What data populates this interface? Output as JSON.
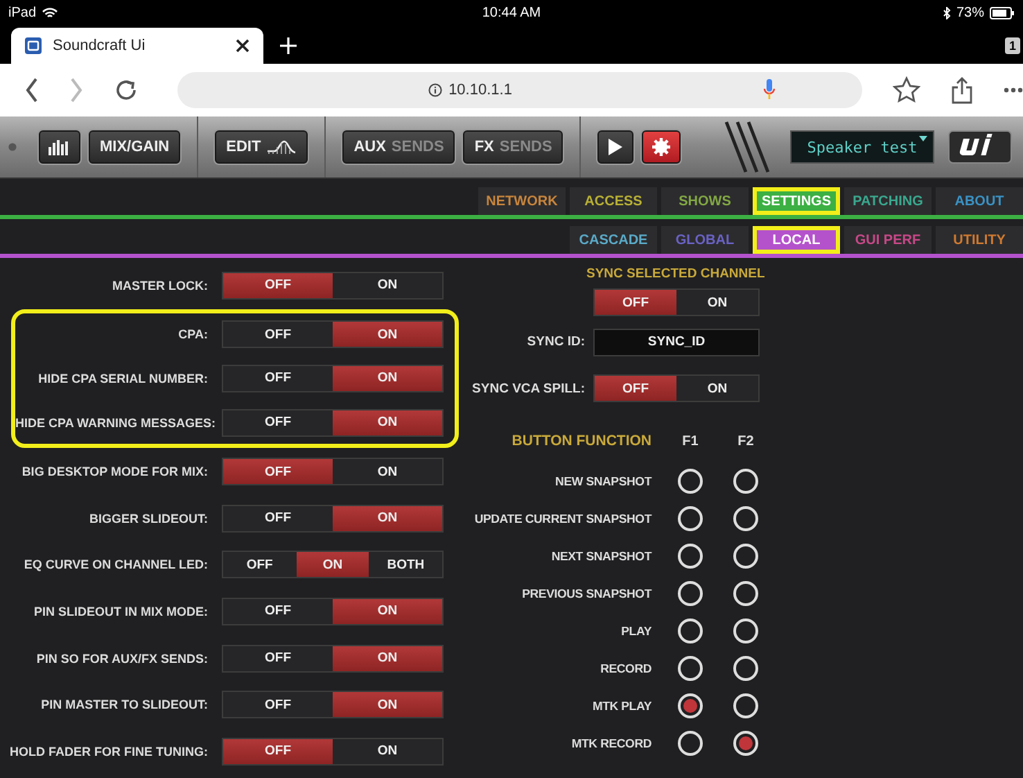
{
  "status_bar": {
    "device": "iPad",
    "time": "10:44 AM",
    "battery": "73%"
  },
  "browser": {
    "tab_title": "Soundcraft Ui",
    "tab_count": "1",
    "url": "10.10.1.1"
  },
  "toolbar": {
    "buttons": [
      {
        "kind": "meter"
      },
      {
        "kind": "text",
        "main": "MIX/GAIN"
      },
      {
        "kind": "edit",
        "main": "EDIT"
      },
      {
        "kind": "split",
        "main": "AUX",
        "sub": "SENDS"
      },
      {
        "kind": "split",
        "main": "FX",
        "sub": "SENDS"
      },
      {
        "kind": "play"
      },
      {
        "kind": "gear"
      }
    ],
    "display": "Speaker test"
  },
  "tabs": [
    {
      "label": "NETWORK",
      "color": "#c8853c",
      "selected": false,
      "highlighted": false
    },
    {
      "label": "ACCESS",
      "color": "#b8b035",
      "selected": false,
      "highlighted": false
    },
    {
      "label": "SHOWS",
      "color": "#82a844",
      "selected": false,
      "highlighted": false
    },
    {
      "label": "SETTINGS",
      "color": "#3cb043",
      "selected": true,
      "highlighted": true
    },
    {
      "label": "PATCHING",
      "color": "#3aa88e",
      "selected": false,
      "highlighted": false
    },
    {
      "label": "ABOUT",
      "color": "#3a92c4",
      "selected": false,
      "highlighted": false
    }
  ],
  "subtabs": [
    {
      "label": "CASCADE",
      "color": "#5aaac8",
      "selected": false,
      "highlighted": false
    },
    {
      "label": "GLOBAL",
      "color": "#6a62c4",
      "selected": false,
      "highlighted": false
    },
    {
      "label": "LOCAL",
      "color": "#b452cc",
      "selected": true,
      "highlighted": true
    },
    {
      "label": "GUI PERF",
      "color": "#c84888",
      "selected": false,
      "highlighted": false
    },
    {
      "label": "UTILITY",
      "color": "#d07a30",
      "selected": false,
      "highlighted": false
    }
  ],
  "settings": [
    {
      "kind": "toggle",
      "label": "MASTER LOCK:",
      "options": [
        {
          "label": "OFF",
          "selected": true
        },
        {
          "label": "ON",
          "selected": false
        }
      ]
    },
    {
      "kind": "group",
      "highlighted": true,
      "items": [
        {
          "kind": "toggle",
          "label": "CPA:",
          "options": [
            {
              "label": "OFF",
              "selected": false
            },
            {
              "label": "ON",
              "selected": true
            }
          ]
        },
        {
          "kind": "toggle",
          "label": "HIDE CPA SERIAL NUMBER:",
          "options": [
            {
              "label": "OFF",
              "selected": false
            },
            {
              "label": "ON",
              "selected": true
            }
          ]
        },
        {
          "kind": "toggle",
          "label": "HIDE CPA WARNING MESSAGES:",
          "options": [
            {
              "label": "OFF",
              "selected": false
            },
            {
              "label": "ON",
              "selected": true
            }
          ]
        }
      ]
    },
    {
      "kind": "toggle",
      "label": "BIG DESKTOP MODE FOR MIX:",
      "options": [
        {
          "label": "OFF",
          "selected": true
        },
        {
          "label": "ON",
          "selected": false
        }
      ]
    },
    {
      "kind": "toggle",
      "label": "BIGGER SLIDEOUT:",
      "options": [
        {
          "label": "OFF",
          "selected": false
        },
        {
          "label": "ON",
          "selected": true
        }
      ]
    },
    {
      "kind": "toggle",
      "label": "EQ CURVE ON CHANNEL LED:",
      "options": [
        {
          "label": "OFF",
          "selected": false
        },
        {
          "label": "ON",
          "selected": true
        },
        {
          "label": "BOTH",
          "selected": false
        }
      ]
    },
    {
      "kind": "toggle",
      "label": "PIN SLIDEOUT IN MIX MODE:",
      "options": [
        {
          "label": "OFF",
          "selected": false
        },
        {
          "label": "ON",
          "selected": true
        }
      ]
    },
    {
      "kind": "toggle",
      "label": "PIN SO FOR AUX/FX SENDS:",
      "options": [
        {
          "label": "OFF",
          "selected": false
        },
        {
          "label": "ON",
          "selected": true
        }
      ]
    },
    {
      "kind": "toggle",
      "label": "PIN MASTER TO SLIDEOUT:",
      "options": [
        {
          "label": "OFF",
          "selected": false
        },
        {
          "label": "ON",
          "selected": true
        }
      ]
    },
    {
      "kind": "toggle",
      "label": "HOLD FADER FOR FINE TUNING:",
      "options": [
        {
          "label": "OFF",
          "selected": true
        },
        {
          "label": "ON",
          "selected": false
        }
      ]
    }
  ],
  "sync_selected_channel": {
    "title": "SYNC SELECTED CHANNEL",
    "options": [
      {
        "label": "OFF",
        "selected": true
      },
      {
        "label": "ON",
        "selected": false
      }
    ]
  },
  "sync_id": {
    "label": "SYNC ID:",
    "value": "SYNC_ID"
  },
  "sync_vca_spill": {
    "label": "SYNC VCA SPILL:",
    "options": [
      {
        "label": "OFF",
        "selected": true
      },
      {
        "label": "ON",
        "selected": false
      }
    ]
  },
  "button_function": {
    "title": "BUTTON FUNCTION",
    "columns": [
      "F1",
      "F2"
    ],
    "rows": [
      {
        "label": "NEW SNAPSHOT",
        "assign": [
          {
            "selected": false
          },
          {
            "selected": false
          }
        ]
      },
      {
        "label": "UPDATE CURRENT SNAPSHOT",
        "assign": [
          {
            "selected": false
          },
          {
            "selected": false
          }
        ]
      },
      {
        "label": "NEXT SNAPSHOT",
        "assign": [
          {
            "selected": false
          },
          {
            "selected": false
          }
        ]
      },
      {
        "label": "PREVIOUS SNAPSHOT",
        "assign": [
          {
            "selected": false
          },
          {
            "selected": false
          }
        ]
      },
      {
        "label": "PLAY",
        "assign": [
          {
            "selected": false
          },
          {
            "selected": false
          }
        ]
      },
      {
        "label": "RECORD",
        "assign": [
          {
            "selected": false
          },
          {
            "selected": false
          }
        ]
      },
      {
        "label": "MTK PLAY",
        "assign": [
          {
            "selected": true
          },
          {
            "selected": false
          }
        ]
      },
      {
        "label": "MTK RECORD",
        "assign": [
          {
            "selected": false
          },
          {
            "selected": true
          }
        ]
      }
    ]
  }
}
